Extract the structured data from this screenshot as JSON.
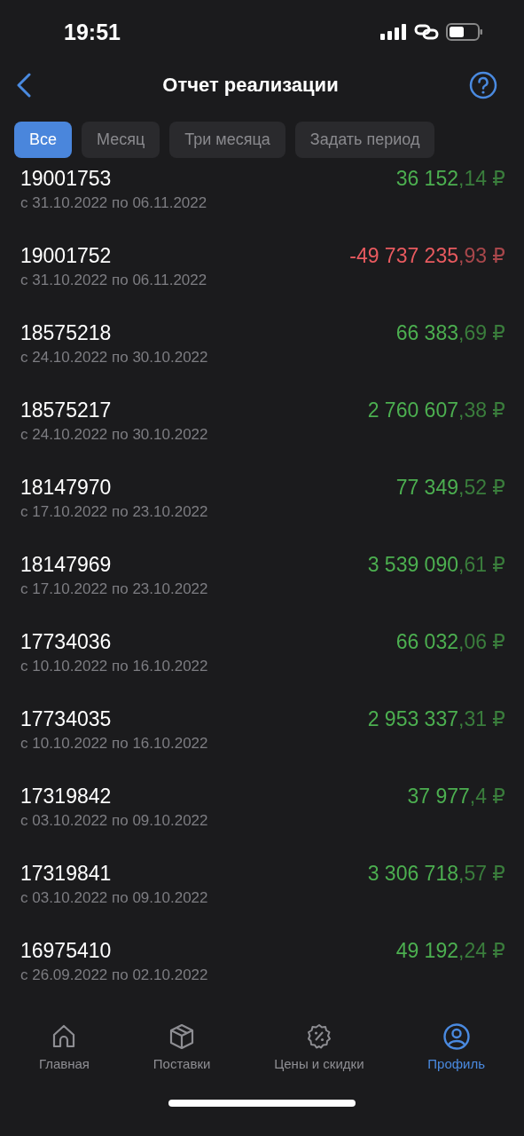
{
  "status_bar": {
    "time": "19:51"
  },
  "header": {
    "title": "Отчет реализации"
  },
  "tabs": [
    {
      "label": "Все",
      "selected": true
    },
    {
      "label": "Месяц",
      "selected": false
    },
    {
      "label": "Три месяца",
      "selected": false
    },
    {
      "label": "Задать период",
      "selected": false
    }
  ],
  "reports": [
    {
      "number": "19001753",
      "period": "с 31.10.2022 по 06.11.2022",
      "amount": "36 152",
      "fraction": ",14 ₽",
      "negative": false
    },
    {
      "number": "19001752",
      "period": "с 31.10.2022 по 06.11.2022",
      "amount": "-49 737 235",
      "fraction": ",93 ₽",
      "negative": true
    },
    {
      "number": "18575218",
      "period": "с 24.10.2022 по 30.10.2022",
      "amount": "66 383",
      "fraction": ",69 ₽",
      "negative": false
    },
    {
      "number": "18575217",
      "period": "с 24.10.2022 по 30.10.2022",
      "amount": "2 760 607",
      "fraction": ",38 ₽",
      "negative": false
    },
    {
      "number": "18147970",
      "period": "с 17.10.2022 по 23.10.2022",
      "amount": "77 349",
      "fraction": ",52 ₽",
      "negative": false
    },
    {
      "number": "18147969",
      "period": "с 17.10.2022 по 23.10.2022",
      "amount": "3 539 090",
      "fraction": ",61 ₽",
      "negative": false
    },
    {
      "number": "17734036",
      "period": "с 10.10.2022 по 16.10.2022",
      "amount": "66 032",
      "fraction": ",06 ₽",
      "negative": false
    },
    {
      "number": "17734035",
      "period": "с 10.10.2022 по 16.10.2022",
      "amount": "2 953 337",
      "fraction": ",31 ₽",
      "negative": false
    },
    {
      "number": "17319842",
      "period": "с 03.10.2022 по 09.10.2022",
      "amount": "37 977",
      "fraction": ",4 ₽",
      "negative": false
    },
    {
      "number": "17319841",
      "period": "с 03.10.2022 по 09.10.2022",
      "amount": "3 306 718",
      "fraction": ",57 ₽",
      "negative": false
    },
    {
      "number": "16975410",
      "period": "с 26.09.2022 по 02.10.2022",
      "amount": "49 192",
      "fraction": ",24 ₽",
      "negative": false
    }
  ],
  "bottom_nav": [
    {
      "kind": "home",
      "label": "Главная",
      "selected": false
    },
    {
      "kind": "box",
      "label": "Поставки",
      "selected": false
    },
    {
      "kind": "discount",
      "label": "Цены и скидки",
      "selected": false
    },
    {
      "kind": "profile",
      "label": "Профиль",
      "selected": true
    }
  ]
}
